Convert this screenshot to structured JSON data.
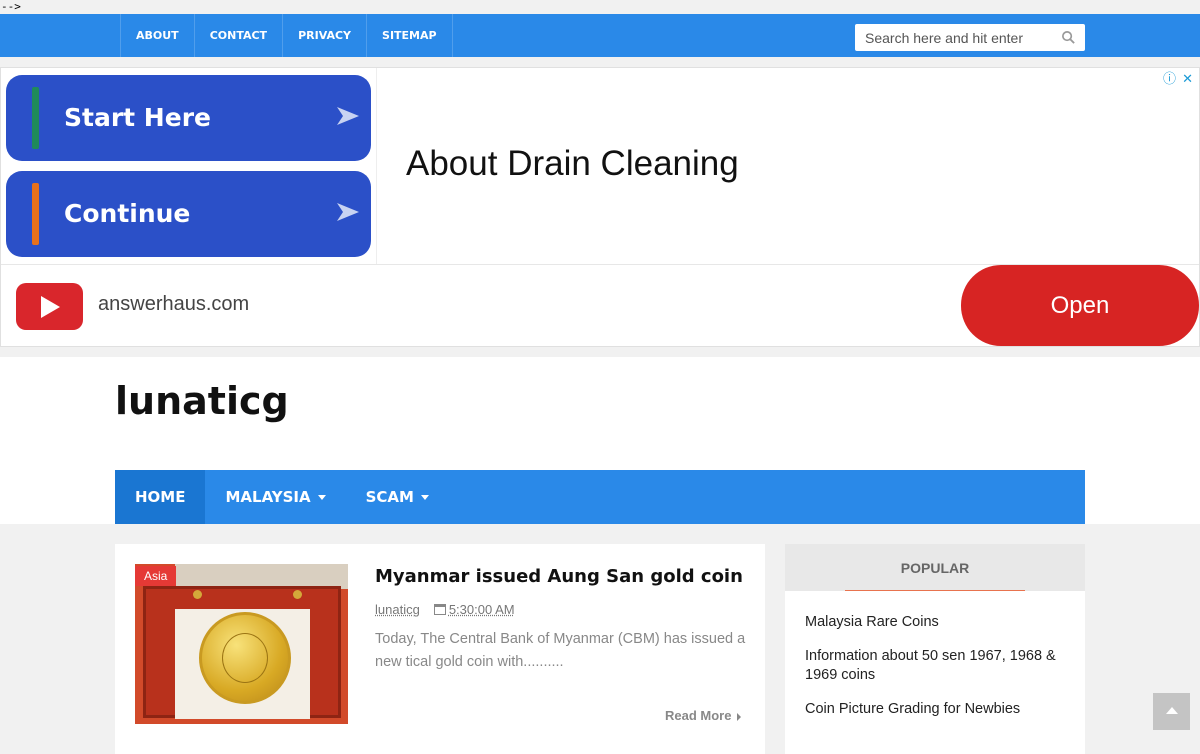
{
  "stray_text": "-->",
  "topbar": {
    "links": [
      "ABOUT",
      "CONTACT",
      "PRIVACY",
      "SITEMAP"
    ],
    "search_placeholder": "Search here and hit enter",
    "color": "#2a89e8"
  },
  "ad": {
    "buttons": [
      {
        "label": "Start Here",
        "bar_color": "#1f8a5a"
      },
      {
        "label": "Continue",
        "bar_color": "#e8711c"
      }
    ],
    "headline": "About Drain Cleaning",
    "choices_icon": "ⓘ",
    "close_icon": "✕",
    "domain": "answerhaus.com",
    "cta": "Open",
    "cta_color": "#d72423"
  },
  "site": {
    "title": "lunaticg"
  },
  "mainnav": {
    "items": [
      {
        "label": "HOME",
        "dropdown": false
      },
      {
        "label": "MALAYSIA",
        "dropdown": true
      },
      {
        "label": "SCAM",
        "dropdown": true
      }
    ]
  },
  "post": {
    "tag": "Asia",
    "title": "Myanmar issued Aung San gold coin",
    "author": "lunaticg",
    "time": "5:30:00 AM",
    "snippet": "Today, The Central Bank of Myanmar (CBM) has issued a new tical gold coin with..........",
    "read_more": "Read More"
  },
  "sidebar": {
    "heading": "POPULAR",
    "items": [
      "Malaysia Rare Coins",
      "Information about 50 sen 1967, 1968 & 1969 coins",
      "Coin Picture Grading for Newbies"
    ]
  }
}
